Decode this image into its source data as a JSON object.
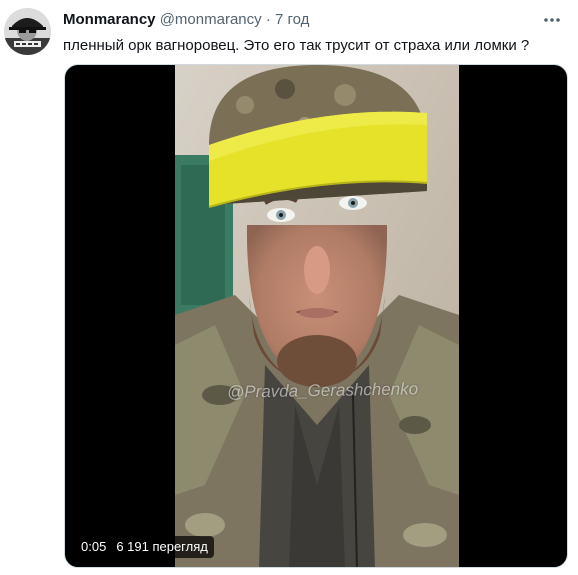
{
  "tweet": {
    "author_name": "Monmarancy",
    "handle": "@monmarancy",
    "separator": "·",
    "time_ago": "7 год",
    "text": "пленный орк вагноровец. Это его так трусит от страха или ломки ?",
    "more_icon": "more-horizontal-icon",
    "avatar_icon": "avatar-image"
  },
  "media": {
    "watermark": "@Pravda_Gerashchenko",
    "duration": "0:05",
    "views": "6 191 перегляд"
  },
  "colors": {
    "text_primary": "#0f1419",
    "text_secondary": "#536471",
    "tape_yellow": "#e6e22a"
  }
}
